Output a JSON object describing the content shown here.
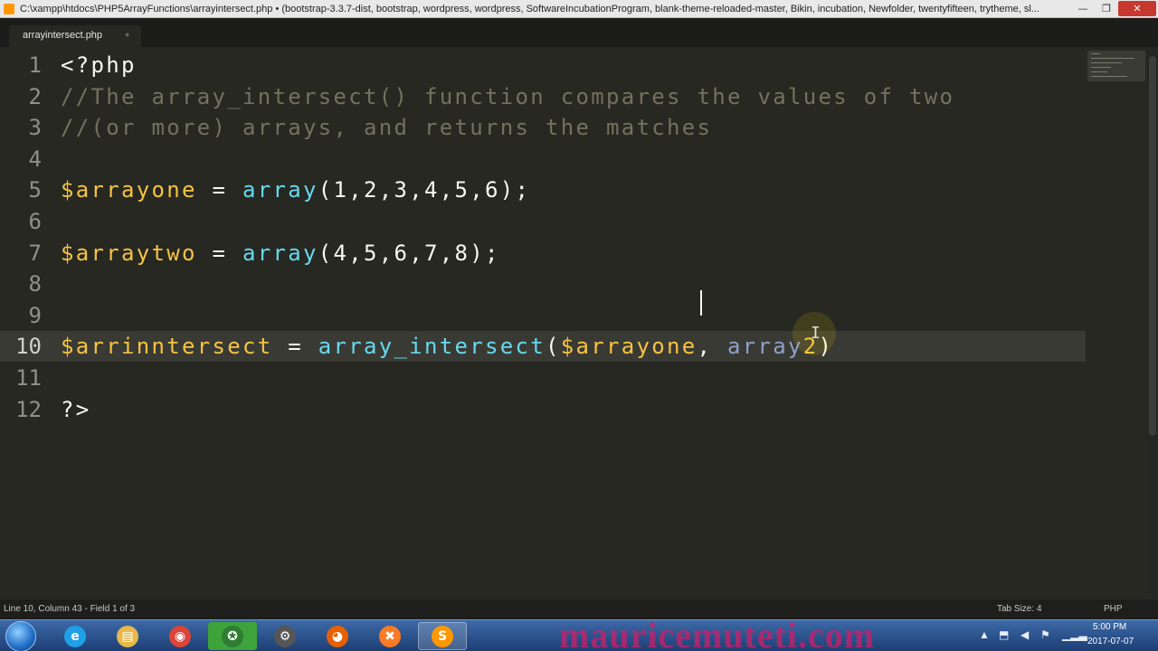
{
  "window": {
    "title": "C:\\xampp\\htdocs\\PHP5ArrayFunctions\\arrayintersect.php • (bootstrap-3.3.7-dist, bootstrap, wordpress, wordpress, SoftwareIncubationProgram, blank-theme-reloaded-master, Bikin, incubation, Newfolder, twentyfifteen, trytheme, sl...",
    "minimize_glyph": "—",
    "maximize_glyph": "❐",
    "close_glyph": "✕"
  },
  "tabs": [
    {
      "label": "arrayintersect.php",
      "close_glyph": "●"
    }
  ],
  "editor": {
    "lines": [
      {
        "num": "1",
        "tokens": [
          {
            "t": "<?php",
            "c": "plain"
          }
        ]
      },
      {
        "num": "2",
        "tokens": [
          {
            "t": "//The array_intersect() function compares the values of two",
            "c": "cmt"
          }
        ]
      },
      {
        "num": "3",
        "tokens": [
          {
            "t": "//(or more) arrays, and returns the matches",
            "c": "cmt"
          }
        ]
      },
      {
        "num": "4",
        "tokens": []
      },
      {
        "num": "5",
        "tokens": [
          {
            "t": "$arrayone",
            "c": "var"
          },
          {
            "t": " = ",
            "c": "plain"
          },
          {
            "t": "array",
            "c": "fn"
          },
          {
            "t": "(1,2,3,4,5,6);",
            "c": "plain"
          }
        ]
      },
      {
        "num": "6",
        "tokens": []
      },
      {
        "num": "7",
        "tokens": [
          {
            "t": "$arraytwo",
            "c": "var"
          },
          {
            "t": " = ",
            "c": "plain"
          },
          {
            "t": "array",
            "c": "fn"
          },
          {
            "t": "(4,5,6,7,8);",
            "c": "plain"
          }
        ]
      },
      {
        "num": "8",
        "tokens": []
      },
      {
        "num": "9",
        "tokens": []
      },
      {
        "num": "10",
        "current": true,
        "tokens": [
          {
            "t": "$arrinntersect",
            "c": "var"
          },
          {
            "t": " = ",
            "c": "plain"
          },
          {
            "t": "array_intersect",
            "c": "fn"
          },
          {
            "t": "(",
            "c": "plain"
          },
          {
            "t": "$arrayone",
            "c": "var"
          },
          {
            "t": ", ",
            "c": "plain"
          },
          {
            "t": "array",
            "c": "dim"
          },
          {
            "t": "2",
            "c": "var"
          },
          {
            "t": ")",
            "c": "plain"
          }
        ]
      },
      {
        "num": "11",
        "tokens": []
      },
      {
        "num": "12",
        "tokens": [
          {
            "t": "?>",
            "c": "plain"
          }
        ]
      }
    ]
  },
  "status": {
    "position": "Line 10, Column 43 - Field 1 of 3",
    "tab_size": "Tab Size: 4",
    "syntax": "PHP"
  },
  "taskbar": {
    "watermark": "mauricemuteti.com",
    "apps": [
      {
        "name": "internet-explorer",
        "glyph": "e",
        "color": "#1fa0e6"
      },
      {
        "name": "file-explorer",
        "glyph": "▤",
        "color": "#e8b84a"
      },
      {
        "name": "chrome",
        "glyph": "◉",
        "color": "#db4437"
      },
      {
        "name": "app-green",
        "glyph": "✪",
        "color": "#2e7d32"
      },
      {
        "name": "app-tool",
        "glyph": "⚙",
        "color": "#555555"
      },
      {
        "name": "firefox",
        "glyph": "◕",
        "color": "#e66000"
      },
      {
        "name": "xampp",
        "glyph": "✖",
        "color": "#fb7a24"
      },
      {
        "name": "sublime-text",
        "glyph": "S",
        "color": "#ff9800"
      }
    ],
    "clock": {
      "time": "5:00 PM",
      "date": "2017-07-07"
    }
  }
}
